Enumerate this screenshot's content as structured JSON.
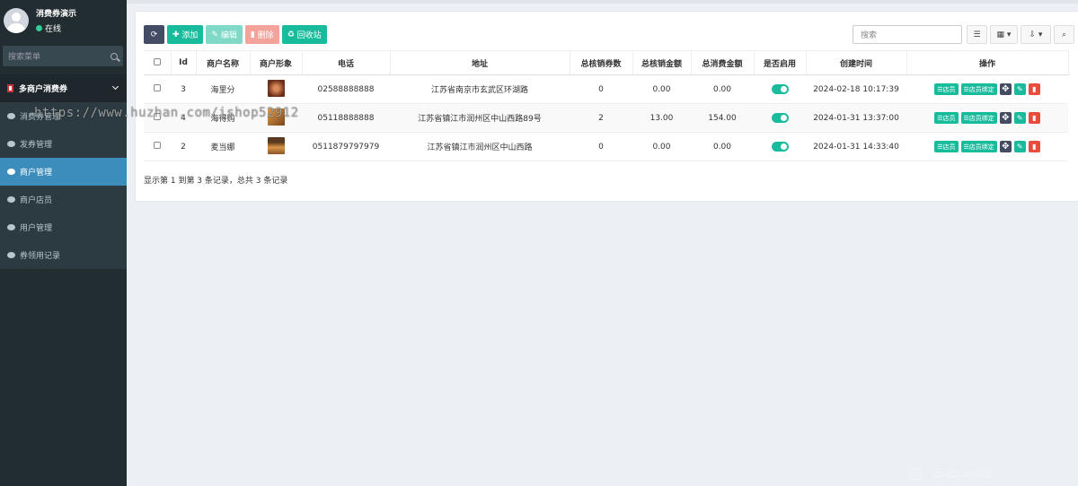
{
  "user": {
    "name": "消费券演示",
    "status": "在线"
  },
  "sidebar": {
    "search_placeholder": "搜索菜单",
    "group": "多商户消费券",
    "items": [
      {
        "label": "消费券管理"
      },
      {
        "label": "发券管理"
      },
      {
        "label": "商户管理"
      },
      {
        "label": "商户店员"
      },
      {
        "label": "用户管理"
      },
      {
        "label": "券领用记录"
      }
    ]
  },
  "toolbar": {
    "add": "添加",
    "edit": "编辑",
    "delete": "删除",
    "recycle": "回收站",
    "search_placeholder": "搜索"
  },
  "table": {
    "columns": [
      "Id",
      "商户名称",
      "商户形象",
      "电话",
      "地址",
      "总核销券数",
      "总核销金额",
      "总消费金额",
      "是否启用",
      "创建时间",
      "操作"
    ],
    "rows": [
      {
        "id": "3",
        "name": "海里分",
        "phone": "02588888888",
        "address": "江苏省南京市玄武区环湖路",
        "count": "0",
        "verified": "0.00",
        "spent": "0.00",
        "created": "2024-02-18 10:17:39",
        "image_color": "#8a4a2a"
      },
      {
        "id": "4",
        "name": "海得购",
        "phone": "05118888888",
        "address": "江苏省镇江市润州区中山西路89号",
        "count": "2",
        "verified": "13.00",
        "spent": "154.00",
        "created": "2024-01-31 13:37:00",
        "image_color": "#b7772f"
      },
      {
        "id": "2",
        "name": "麦当娜",
        "phone": "0511879797979",
        "address": "江苏省镇江市润州区中山西路",
        "count": "0",
        "verified": "0.00",
        "spent": "0.00",
        "created": "2024-01-31 14:33:40",
        "image_color": "#c2813a"
      }
    ],
    "op_store": "店员",
    "op_bind": "店员绑定",
    "footer": "显示第 1 到第 3 条记录，总共 3 条记录"
  },
  "watermark": "https://www.huzhan.com/ishop52912"
}
